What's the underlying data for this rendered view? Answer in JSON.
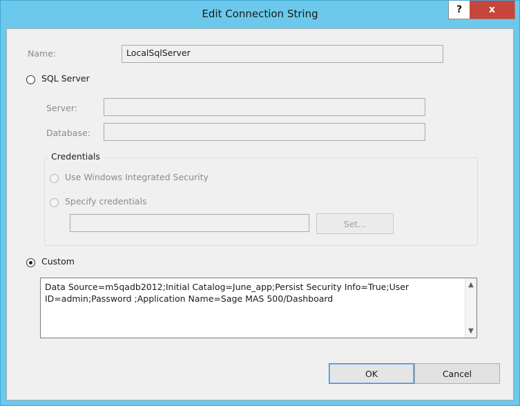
{
  "window": {
    "title": "Edit Connection String",
    "help_label": "?",
    "close_label": "x"
  },
  "name": {
    "label": "Name:",
    "value": "LocalSqlServer"
  },
  "sql_server": {
    "radio_label": "SQL Server",
    "selected": false,
    "server_label": "Server:",
    "server_value": "",
    "database_label": "Database:",
    "database_value": ""
  },
  "credentials": {
    "group_label": "Credentials",
    "windows_integrated_label": "Use Windows Integrated Security",
    "specify_label": "Specify credentials",
    "credentials_value": "",
    "set_button_label": "Set..."
  },
  "custom": {
    "radio_label": "Custom",
    "selected": true,
    "connection_string": "Data Source=m5qadb2012;Initial Catalog=June_app;Persist Security Info=True;User ID=admin;Password ;Application Name=Sage MAS 500/Dashboard"
  },
  "buttons": {
    "ok_label": "OK",
    "cancel_label": "Cancel"
  },
  "icons": {
    "scroll_up": "chevron-up-icon",
    "scroll_down": "chevron-down-icon"
  }
}
